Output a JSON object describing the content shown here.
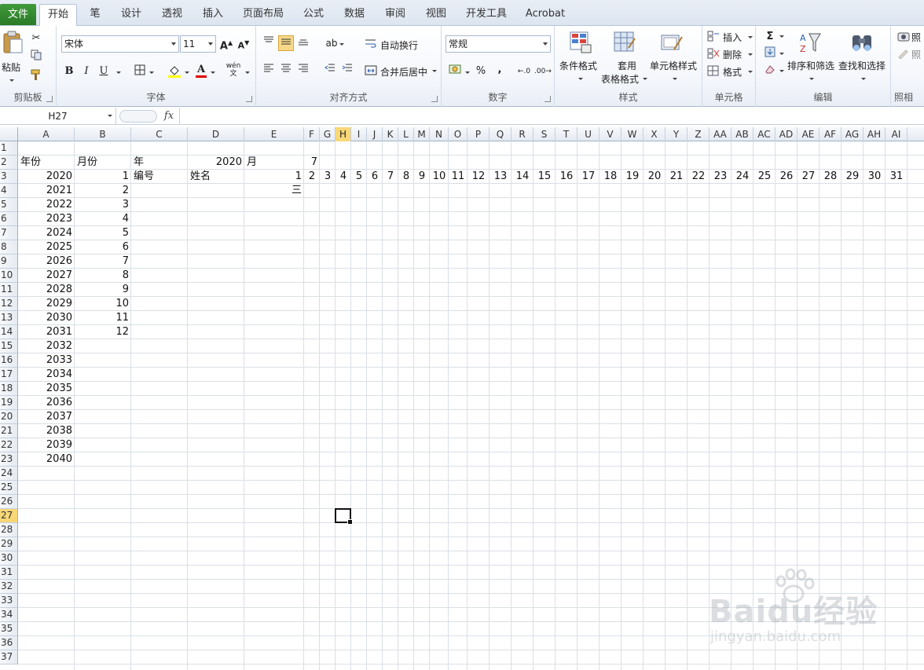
{
  "ribbon_tabs": [
    "文件",
    "开始",
    "笔",
    "设计",
    "透视",
    "插入",
    "页面布局",
    "公式",
    "数据",
    "审阅",
    "视图",
    "开发工具",
    "Acrobat"
  ],
  "active_tab": "开始",
  "clipboard": {
    "paste": "粘贴",
    "group": "剪贴板"
  },
  "font": {
    "name": "宋体",
    "size": "11",
    "bold": "B",
    "italic": "I",
    "underline": "U",
    "group": "字体",
    "phonetic": "wén"
  },
  "alignment": {
    "wrap": "自动换行",
    "merge": "合并后居中",
    "group": "对齐方式"
  },
  "number": {
    "format": "常规",
    "percent": "%",
    "comma": ",",
    "group": "数字"
  },
  "styles": {
    "conditional": "条件格式",
    "table_1": "套用",
    "table_2": "表格格式",
    "cell_styles": "单元格样式",
    "group": "样式"
  },
  "cells": {
    "insert": "插入",
    "delete": "删除",
    "format": "格式",
    "group": "单元格"
  },
  "editing": {
    "sum": "Σ",
    "sort": "排序和筛选",
    "find": "查找和选择",
    "group": "编辑"
  },
  "camera": {
    "label_1": "照",
    "label_2": "照",
    "group": "照相"
  },
  "formula_bar": {
    "name_box": "H27",
    "fx": "fx",
    "formula": ""
  },
  "columns": [
    "A",
    "B",
    "C",
    "D",
    "E",
    "F",
    "G",
    "H",
    "I",
    "J",
    "K",
    "L",
    "M",
    "N",
    "O",
    "P",
    "Q",
    "R",
    "S",
    "T",
    "U",
    "V",
    "W",
    "X",
    "Y",
    "Z",
    "AA",
    "AB",
    "AC",
    "AD",
    "AE",
    "AF",
    "AG",
    "AH",
    "AI"
  ],
  "selected_column": "H",
  "rows": [
    "1",
    "2",
    "3",
    "4",
    "5",
    "6",
    "7",
    "8",
    "9",
    "10",
    "11",
    "12",
    "13",
    "14",
    "15",
    "16",
    "17",
    "18",
    "19",
    "20",
    "21",
    "22",
    "23",
    "24",
    "25",
    "26",
    "27",
    "28",
    "29",
    "30",
    "31",
    "32",
    "33",
    "34",
    "35",
    "36",
    "37"
  ],
  "selected_row": "27",
  "sheet": {
    "A2": "年份",
    "B2": "月份",
    "C2": "年",
    "D2": "2020",
    "E2": "月",
    "F2": "7",
    "C3": "编号",
    "D3": "姓名",
    "A_years": [
      "2020",
      "2021",
      "2022",
      "2023",
      "2024",
      "2025",
      "2026",
      "2027",
      "2028",
      "2029",
      "2030",
      "2031",
      "2032",
      "2033",
      "2034",
      "2035",
      "2036",
      "2037",
      "2038",
      "2039",
      "2040"
    ],
    "B_months": [
      "1",
      "2",
      "3",
      "4",
      "5",
      "6",
      "7",
      "8",
      "9",
      "10",
      "11",
      "12"
    ],
    "day_numbers": [
      "1",
      "2",
      "3",
      "4",
      "5",
      "6",
      "7",
      "8",
      "9",
      "10",
      "11",
      "12",
      "13",
      "14",
      "15",
      "16",
      "17",
      "18",
      "19",
      "20",
      "21",
      "22",
      "23",
      "24",
      "25",
      "26",
      "27",
      "28",
      "29",
      "30",
      "31"
    ],
    "E4": "三"
  },
  "watermark": {
    "main": "Baidu经验",
    "sub": "jingyan.baidu.com"
  }
}
